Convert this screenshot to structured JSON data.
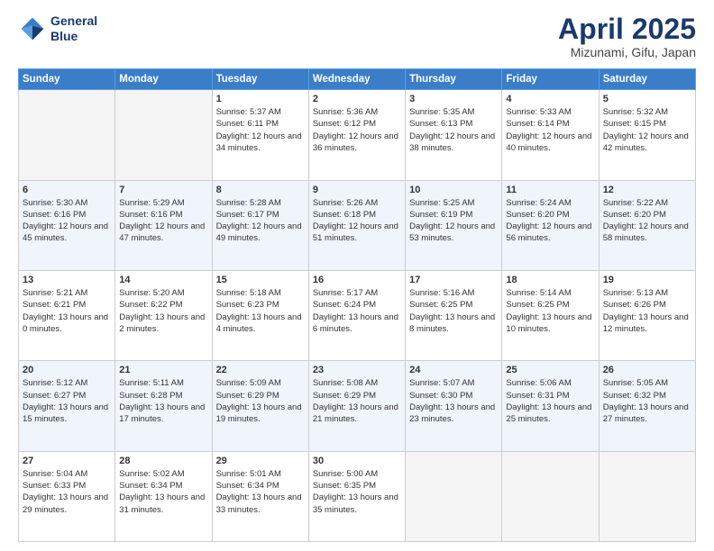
{
  "header": {
    "logo_line1": "General",
    "logo_line2": "Blue",
    "title": "April 2025",
    "location": "Mizunami, Gifu, Japan"
  },
  "days_of_week": [
    "Sunday",
    "Monday",
    "Tuesday",
    "Wednesday",
    "Thursday",
    "Friday",
    "Saturday"
  ],
  "weeks": [
    [
      {
        "day": "",
        "info": ""
      },
      {
        "day": "",
        "info": ""
      },
      {
        "day": "1",
        "info": "Sunrise: 5:37 AM\nSunset: 6:11 PM\nDaylight: 12 hours and 34 minutes."
      },
      {
        "day": "2",
        "info": "Sunrise: 5:36 AM\nSunset: 6:12 PM\nDaylight: 12 hours and 36 minutes."
      },
      {
        "day": "3",
        "info": "Sunrise: 5:35 AM\nSunset: 6:13 PM\nDaylight: 12 hours and 38 minutes."
      },
      {
        "day": "4",
        "info": "Sunrise: 5:33 AM\nSunset: 6:14 PM\nDaylight: 12 hours and 40 minutes."
      },
      {
        "day": "5",
        "info": "Sunrise: 5:32 AM\nSunset: 6:15 PM\nDaylight: 12 hours and 42 minutes."
      }
    ],
    [
      {
        "day": "6",
        "info": "Sunrise: 5:30 AM\nSunset: 6:16 PM\nDaylight: 12 hours and 45 minutes."
      },
      {
        "day": "7",
        "info": "Sunrise: 5:29 AM\nSunset: 6:16 PM\nDaylight: 12 hours and 47 minutes."
      },
      {
        "day": "8",
        "info": "Sunrise: 5:28 AM\nSunset: 6:17 PM\nDaylight: 12 hours and 49 minutes."
      },
      {
        "day": "9",
        "info": "Sunrise: 5:26 AM\nSunset: 6:18 PM\nDaylight: 12 hours and 51 minutes."
      },
      {
        "day": "10",
        "info": "Sunrise: 5:25 AM\nSunset: 6:19 PM\nDaylight: 12 hours and 53 minutes."
      },
      {
        "day": "11",
        "info": "Sunrise: 5:24 AM\nSunset: 6:20 PM\nDaylight: 12 hours and 56 minutes."
      },
      {
        "day": "12",
        "info": "Sunrise: 5:22 AM\nSunset: 6:20 PM\nDaylight: 12 hours and 58 minutes."
      }
    ],
    [
      {
        "day": "13",
        "info": "Sunrise: 5:21 AM\nSunset: 6:21 PM\nDaylight: 13 hours and 0 minutes."
      },
      {
        "day": "14",
        "info": "Sunrise: 5:20 AM\nSunset: 6:22 PM\nDaylight: 13 hours and 2 minutes."
      },
      {
        "day": "15",
        "info": "Sunrise: 5:18 AM\nSunset: 6:23 PM\nDaylight: 13 hours and 4 minutes."
      },
      {
        "day": "16",
        "info": "Sunrise: 5:17 AM\nSunset: 6:24 PM\nDaylight: 13 hours and 6 minutes."
      },
      {
        "day": "17",
        "info": "Sunrise: 5:16 AM\nSunset: 6:25 PM\nDaylight: 13 hours and 8 minutes."
      },
      {
        "day": "18",
        "info": "Sunrise: 5:14 AM\nSunset: 6:25 PM\nDaylight: 13 hours and 10 minutes."
      },
      {
        "day": "19",
        "info": "Sunrise: 5:13 AM\nSunset: 6:26 PM\nDaylight: 13 hours and 12 minutes."
      }
    ],
    [
      {
        "day": "20",
        "info": "Sunrise: 5:12 AM\nSunset: 6:27 PM\nDaylight: 13 hours and 15 minutes."
      },
      {
        "day": "21",
        "info": "Sunrise: 5:11 AM\nSunset: 6:28 PM\nDaylight: 13 hours and 17 minutes."
      },
      {
        "day": "22",
        "info": "Sunrise: 5:09 AM\nSunset: 6:29 PM\nDaylight: 13 hours and 19 minutes."
      },
      {
        "day": "23",
        "info": "Sunrise: 5:08 AM\nSunset: 6:29 PM\nDaylight: 13 hours and 21 minutes."
      },
      {
        "day": "24",
        "info": "Sunrise: 5:07 AM\nSunset: 6:30 PM\nDaylight: 13 hours and 23 minutes."
      },
      {
        "day": "25",
        "info": "Sunrise: 5:06 AM\nSunset: 6:31 PM\nDaylight: 13 hours and 25 minutes."
      },
      {
        "day": "26",
        "info": "Sunrise: 5:05 AM\nSunset: 6:32 PM\nDaylight: 13 hours and 27 minutes."
      }
    ],
    [
      {
        "day": "27",
        "info": "Sunrise: 5:04 AM\nSunset: 6:33 PM\nDaylight: 13 hours and 29 minutes."
      },
      {
        "day": "28",
        "info": "Sunrise: 5:02 AM\nSunset: 6:34 PM\nDaylight: 13 hours and 31 minutes."
      },
      {
        "day": "29",
        "info": "Sunrise: 5:01 AM\nSunset: 6:34 PM\nDaylight: 13 hours and 33 minutes."
      },
      {
        "day": "30",
        "info": "Sunrise: 5:00 AM\nSunset: 6:35 PM\nDaylight: 13 hours and 35 minutes."
      },
      {
        "day": "",
        "info": ""
      },
      {
        "day": "",
        "info": ""
      },
      {
        "day": "",
        "info": ""
      }
    ]
  ]
}
